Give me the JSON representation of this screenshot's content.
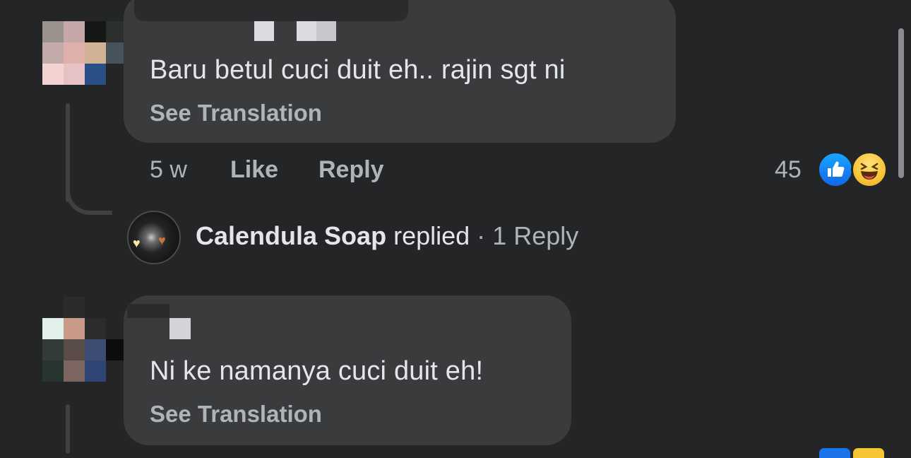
{
  "comments": [
    {
      "text": "Baru betul cuci duit eh.. rajin sgt ni",
      "see_translation": "See Translation",
      "time": "5 w",
      "like_label": "Like",
      "reply_label": "Reply",
      "reaction_count": "45",
      "reactions": [
        "like-icon",
        "haha-icon"
      ]
    },
    {
      "text": "Ni ke namanya cuci duit eh!",
      "see_translation": "See Translation"
    }
  ],
  "reply_summary": {
    "page_name": "Calendula Soap",
    "action": "replied",
    "separator": "·",
    "count_label": "1 Reply"
  },
  "colors": {
    "background": "#242526",
    "bubble": "#3a3b3c",
    "text_primary": "#e4e6eb",
    "text_secondary": "#b0b3b8",
    "like_blue": "#1877f2",
    "haha_yellow": "#f7c436"
  }
}
